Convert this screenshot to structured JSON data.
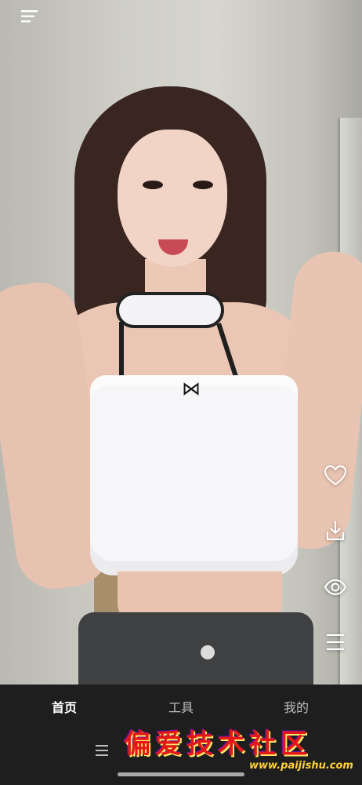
{
  "top_bar": {
    "menu_icon": "menu-icon"
  },
  "side_actions": [
    {
      "icon": "heart-icon"
    },
    {
      "icon": "download-icon"
    },
    {
      "icon": "eye-icon"
    },
    {
      "icon": "list-menu-icon"
    }
  ],
  "bottom_nav": {
    "tabs": [
      {
        "label": "首页",
        "active": true
      },
      {
        "label": "工具",
        "active": false
      },
      {
        "label": "我的",
        "active": false
      }
    ],
    "menu_icon": "menu-icon"
  },
  "watermark": {
    "text": "偏爱技术社区",
    "url": "www.paijishu.com"
  },
  "colors": {
    "nav_background": "#1e1e1e",
    "active_tab": "#ffffff",
    "inactive_tab": "#bdbdbd",
    "watermark_red": "#e31717",
    "watermark_url": "#ffd23a"
  }
}
